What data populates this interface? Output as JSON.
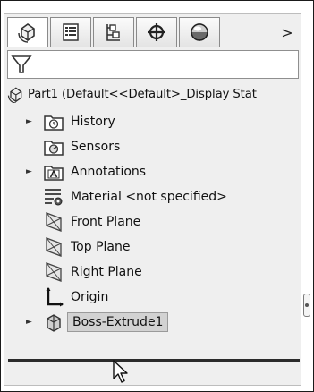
{
  "tabs": [
    {
      "icon": "featuremanager-icon",
      "active": true
    },
    {
      "icon": "propertymanager-icon",
      "active": false
    },
    {
      "icon": "configurationmanager-icon",
      "active": false
    },
    {
      "icon": "dimxpertmanager-icon",
      "active": false
    },
    {
      "icon": "displaymanager-icon",
      "active": false
    }
  ],
  "more_tabs_glyph": ">",
  "filter": {
    "icon": "filter-icon"
  },
  "tree": {
    "root_label": "Part1  (Default<<Default>_Display Stat",
    "items": [
      {
        "label": "History",
        "icon": "history-folder-icon",
        "expandable": true
      },
      {
        "label": "Sensors",
        "icon": "sensors-folder-icon",
        "expandable": false
      },
      {
        "label": "Annotations",
        "icon": "annotations-folder-icon",
        "expandable": true
      },
      {
        "label": "Material <not specified>",
        "icon": "material-icon",
        "expandable": false
      },
      {
        "label": "Front Plane",
        "icon": "plane-icon",
        "expandable": false
      },
      {
        "label": "Top Plane",
        "icon": "plane-icon",
        "expandable": false
      },
      {
        "label": "Right Plane",
        "icon": "plane-icon",
        "expandable": false
      },
      {
        "label": "Origin",
        "icon": "origin-icon",
        "expandable": false
      },
      {
        "label": "Boss-Extrude1",
        "icon": "extrude-feature-icon",
        "expandable": true,
        "selected": true
      }
    ]
  }
}
